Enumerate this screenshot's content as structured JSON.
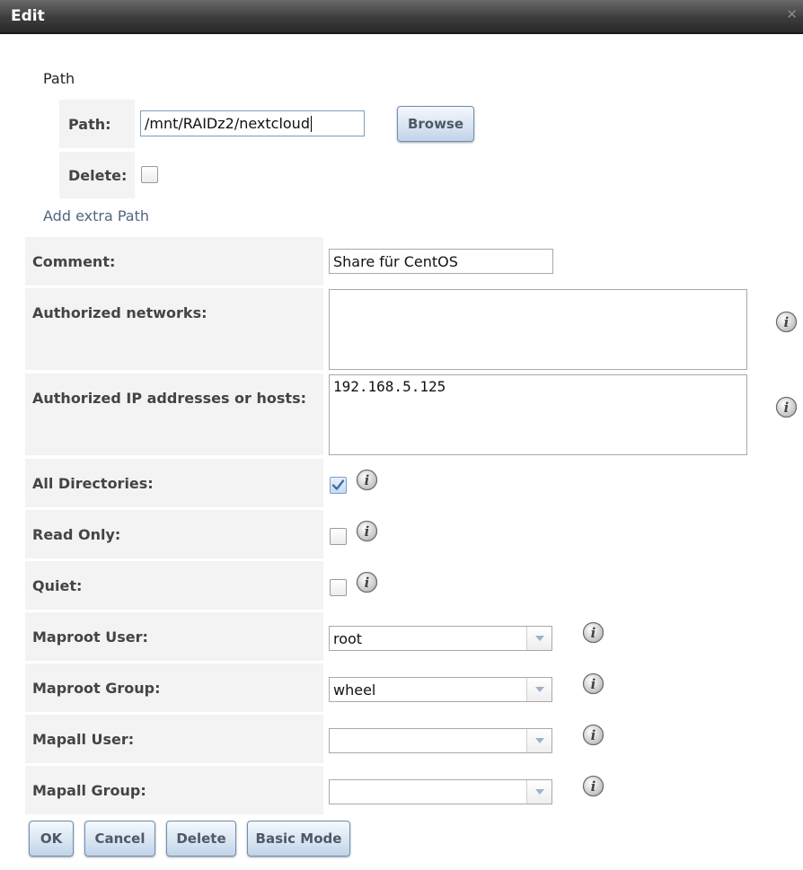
{
  "window": {
    "title": "Edit",
    "close_glyph": "✕"
  },
  "path_section": {
    "label": "Path",
    "path_label": "Path:",
    "path_value": "/mnt/RAIDz2/nextcloud",
    "browse_label": "Browse",
    "delete_label": "Delete:",
    "delete_checked": false,
    "add_extra_path": "Add extra Path"
  },
  "form": {
    "comment_label": "Comment:",
    "comment_value": "Share für CentOS",
    "authorized_networks_label": "Authorized networks:",
    "authorized_networks_value": "",
    "authorized_ip_label": "Authorized IP addresses or hosts:",
    "authorized_ip_value": "192.168.5.125",
    "all_directories_label": "All Directories:",
    "all_directories_checked": true,
    "read_only_label": "Read Only:",
    "read_only_checked": false,
    "quiet_label": "Quiet:",
    "quiet_checked": false,
    "maproot_user_label": "Maproot User:",
    "maproot_user_value": "root",
    "maproot_group_label": "Maproot Group:",
    "maproot_group_value": "wheel",
    "mapall_user_label": "Mapall User:",
    "mapall_user_value": "",
    "mapall_group_label": "Mapall Group:",
    "mapall_group_value": ""
  },
  "buttons": {
    "ok": "OK",
    "cancel": "Cancel",
    "delete": "Delete",
    "basic_mode": "Basic Mode"
  },
  "icons": {
    "info": "info-icon",
    "checkmark": "checkmark-icon",
    "dropdown": "chevron-down-icon",
    "close": "close-icon"
  },
  "colors": {
    "titlebar": "#3c3c3c",
    "label_background": "#f3f3f3",
    "button_blue": "#d6e3f1",
    "link": "#51667e"
  }
}
